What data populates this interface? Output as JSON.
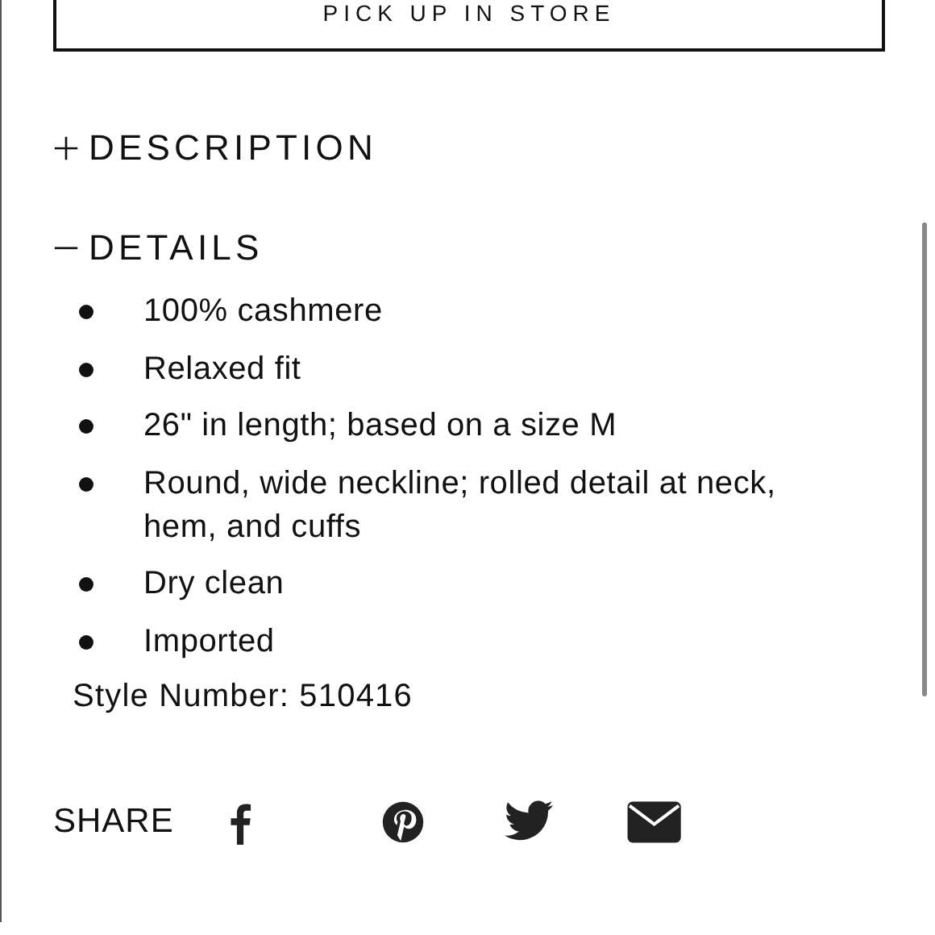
{
  "pickup_button": {
    "label": "PICK UP IN STORE"
  },
  "sections": [
    {
      "title": "DESCRIPTION",
      "expanded": false
    },
    {
      "title": "DETAILS",
      "expanded": true,
      "bullets": [
        "100% cashmere",
        "Relaxed fit",
        "26\" in length; based on a size M",
        "Round, wide neckline; rolled detail at neck, hem, and cuffs",
        "Dry clean",
        "Imported"
      ],
      "style_number": "Style Number: 510416"
    }
  ],
  "share": {
    "label": "SHARE",
    "icons": [
      {
        "kind": "facebook"
      },
      {
        "kind": "pinterest"
      },
      {
        "kind": "twitter"
      },
      {
        "kind": "email"
      }
    ]
  }
}
